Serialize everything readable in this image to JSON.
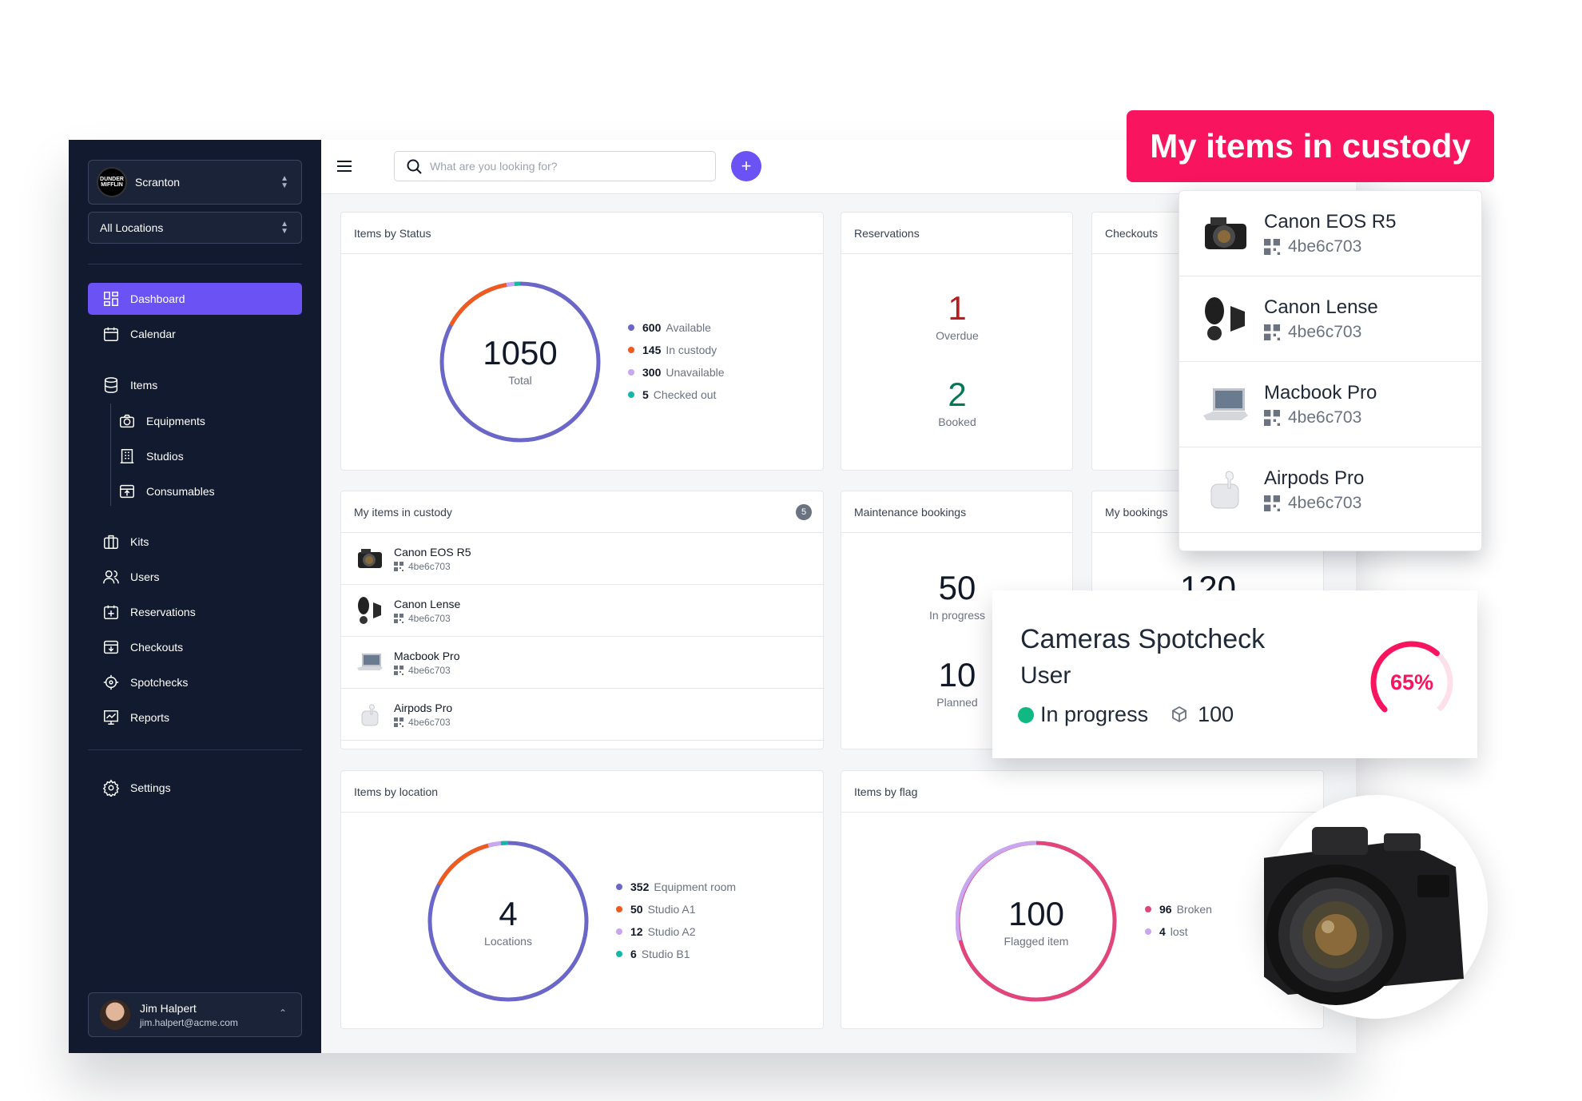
{
  "sidebar": {
    "org_name": "Scranton",
    "org_logo_text": "DUNDER MIFFLIN",
    "location_select": "All Locations",
    "nav": {
      "dashboard": "Dashboard",
      "calendar": "Calendar",
      "items": "Items",
      "equipments": "Equipments",
      "studios": "Studios",
      "consumables": "Consumables",
      "kits": "Kits",
      "users": "Users",
      "reservations": "Reservations",
      "checkouts": "Checkouts",
      "spotchecks": "Spotchecks",
      "reports": "Reports",
      "settings": "Settings"
    },
    "user": {
      "name": "Jim Halpert",
      "email": "jim.halpert@acme.com"
    }
  },
  "topbar": {
    "search_placeholder": "What are you looking for?",
    "add_label": "+"
  },
  "cards": {
    "items_by_status": {
      "title": "Items by Status",
      "total": "1050",
      "total_label": "Total",
      "legend": [
        {
          "value": "600",
          "label": "Available",
          "color": "#6b67c8"
        },
        {
          "value": "145",
          "label": "In custody",
          "color": "#f05a1e"
        },
        {
          "value": "300",
          "label": "Unavailable",
          "color": "#c9a6f0"
        },
        {
          "value": "5",
          "label": "Checked out",
          "color": "#14b8a6"
        }
      ]
    },
    "reservations": {
      "title": "Reservations",
      "overdue_value": "1",
      "overdue_label": "Overdue",
      "booked_value": "2",
      "booked_label": "Booked"
    },
    "checkouts": {
      "title": "Checkouts"
    },
    "my_items": {
      "title": "My items in custody",
      "count": "5",
      "items": [
        {
          "name": "Canon EOS R5",
          "code": "4be6c703"
        },
        {
          "name": "Canon Lense",
          "code": "4be6c703"
        },
        {
          "name": "Macbook Pro",
          "code": "4be6c703"
        },
        {
          "name": "Airpods Pro",
          "code": "4be6c703"
        }
      ]
    },
    "maintenance": {
      "title": "Maintenance bookings",
      "in_progress_value": "50",
      "in_progress_label": "In progress",
      "planned_value": "10",
      "planned_label": "Planned"
    },
    "my_bookings": {
      "title": "My bookings",
      "value_partial": "120"
    },
    "items_by_location": {
      "title": "Items by location",
      "total": "4",
      "total_label": "Locations",
      "legend": [
        {
          "value": "352",
          "label": "Equipment room",
          "color": "#6b67c8"
        },
        {
          "value": "50",
          "label": "Studio A1",
          "color": "#f05a1e"
        },
        {
          "value": "12",
          "label": "Studio A2",
          "color": "#c9a6f0"
        },
        {
          "value": "6",
          "label": "Studio B1",
          "color": "#14b8a6"
        }
      ]
    },
    "items_by_flag": {
      "title": "Items by flag",
      "total": "100",
      "total_label": "Flagged item",
      "legend": [
        {
          "value": "96",
          "label": "Broken",
          "color": "#e0457b"
        },
        {
          "value": "4",
          "label": "lost",
          "color": "#c9a6f0"
        }
      ]
    }
  },
  "overlay": {
    "banner": "My items in custody",
    "popup_items": [
      {
        "name": "Canon EOS R5",
        "code": "4be6c703"
      },
      {
        "name": "Canon Lense",
        "code": "4be6c703"
      },
      {
        "name": "Macbook Pro",
        "code": "4be6c703"
      },
      {
        "name": "Airpods Pro",
        "code": "4be6c703"
      }
    ],
    "spotcheck": {
      "title": "Cameras Spotcheck",
      "role": "User",
      "status": "In progress",
      "count": "100",
      "percent_label": "65%",
      "percent_value": 0.65
    }
  },
  "colors": {
    "accent": "#6b52f5",
    "sidebar_bg": "#111a2e",
    "banner": "#f8145f",
    "overdue": "#b91c1c",
    "booked": "#047857"
  }
}
